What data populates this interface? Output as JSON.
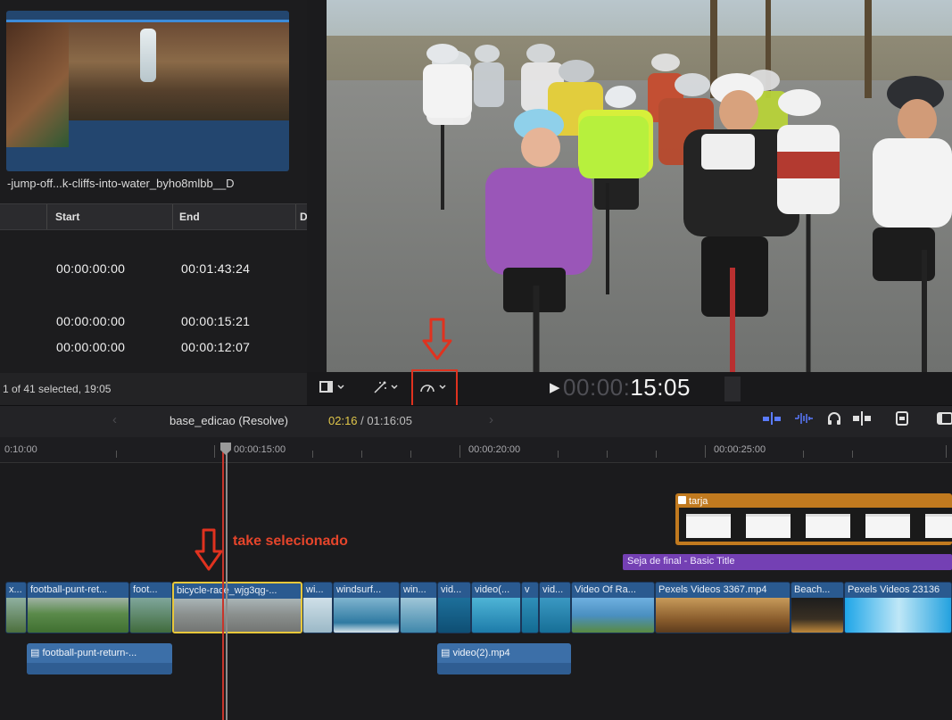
{
  "browser": {
    "clip_name": "-jump-off...k-cliffs-into-water_byho8mlbb__D",
    "columns": [
      "Start",
      "End",
      "D"
    ],
    "rows": [
      {
        "start": "00:00:00:00",
        "end": "00:01:43:24"
      },
      {
        "start": "00:00:00:00",
        "end": "00:00:15:21"
      },
      {
        "start": "00:00:00:00",
        "end": "00:00:12:07"
      }
    ],
    "status": "1 of 41 selected, 19:05"
  },
  "viewer_toolbar": {
    "view_icon": "view-options-icon",
    "transform_icon": "transform-icon",
    "speed_icon": "retime-speedometer-icon",
    "timecode_dim": "00:00:",
    "timecode_bright": "15:05"
  },
  "timeline_header": {
    "project_name": "base_edicao (Resolve)",
    "current": "02:16",
    "total": "/ 01:16:05",
    "icons": [
      "audio-meters-icon",
      "waveform-icon",
      "headphones-icon",
      "skimming-icon",
      "clip-appearance-icon",
      "index-icon"
    ]
  },
  "ruler": {
    "labels": [
      "0:10:00",
      "00:00:15:00",
      "00:00:20:00",
      "00:00:25:00"
    ]
  },
  "annotations": {
    "take_label": "take selecionado"
  },
  "title_clip": {
    "label": "tarja"
  },
  "title_bar": {
    "label": "Seja de final - Basic Title"
  },
  "primary_clips": [
    {
      "label": "x..."
    },
    {
      "label": "football-punt-ret..."
    },
    {
      "label": "foot..."
    },
    {
      "label": "bicycle-race_wjg3qg-..."
    },
    {
      "label": "wi..."
    },
    {
      "label": "windsurf..."
    },
    {
      "label": "win..."
    },
    {
      "label": "vid..."
    },
    {
      "label": "video(..."
    },
    {
      "label": "v"
    },
    {
      "label": "vid..."
    },
    {
      "label": "Video Of Ra..."
    },
    {
      "label": "Pexels Videos 3367.mp4"
    },
    {
      "label": "Beach..."
    },
    {
      "label": "Pexels Videos 23136"
    }
  ],
  "connected_clips": [
    {
      "label": "football-punt-return-..."
    },
    {
      "label": "video(2).mp4"
    }
  ],
  "colors": {
    "accent_red": "#e0321f",
    "timecode_yellow": "#e0c64a",
    "title_purple": "#7440b4",
    "title_orange": "#c17a1f",
    "clip_blue": "#2a5a90",
    "selection_yellow": "#e8c83a"
  }
}
